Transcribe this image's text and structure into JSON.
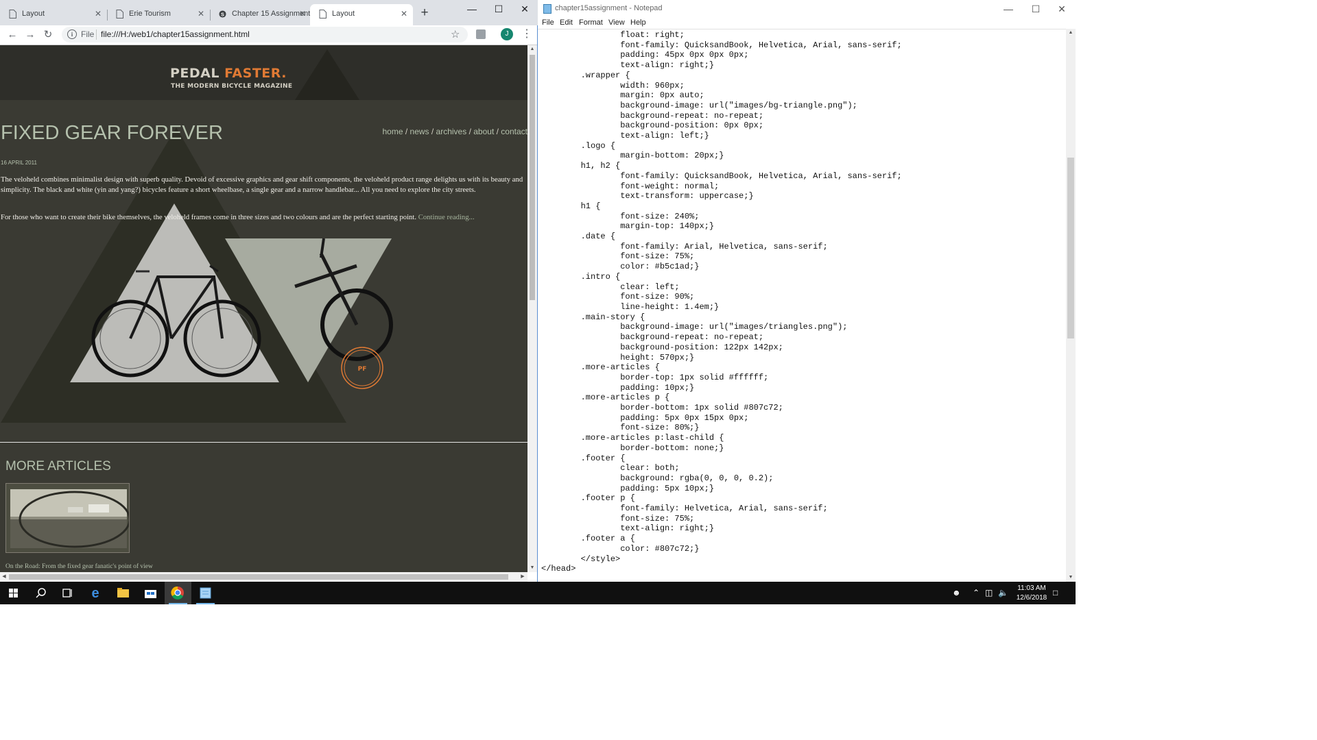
{
  "browser": {
    "tabs": [
      {
        "title": "Layout"
      },
      {
        "title": "Erie Tourism"
      },
      {
        "title": "Chapter 15 Assignment"
      },
      {
        "title": "Layout"
      }
    ],
    "address_scheme": "File",
    "address_url": "file:///H:/web1/chapter15assignment.html",
    "avatar_letter": "J"
  },
  "page": {
    "logo_word1": "PEDAL",
    "logo_word2": "FASTER.",
    "logo_tagline": "THE MODERN BICYCLE MAGAZINE",
    "nav": [
      "home",
      "news",
      "archives",
      "about",
      "contact"
    ],
    "nav_separator": " / ",
    "h1": "FIXED GEAR FOREVER",
    "date": "16 APRIL 2011",
    "p1": "The veloheld combines minimalist design with superb quality. Devoid of excessive graphics and gear shift components, the veloheld product range delights us with its beauty and simplicity. The black and white (yin and yang?) bicycles feature a short wheelbase, a single gear and a narrow handlebar... All you need to explore the city streets.",
    "p2": "For those who want to create their bike themselves, the veloheld frames come in three sizes and two colours and are the perfect starting point.",
    "continue_link": "Continue reading...",
    "badge_letters": "PF",
    "more_articles_heading": "MORE ARTICLES",
    "article_caption": "On the Road: From the fixed gear fanatic's point of view",
    "colors": {
      "green": "#b5c1ad",
      "orange": "#e07a34",
      "border": "#807c72",
      "background": "#3a3a33"
    }
  },
  "notepad": {
    "title": "chapter15assignment - Notepad",
    "menu": [
      "File",
      "Edit",
      "Format",
      "View",
      "Help"
    ],
    "code": "                float: right;\n                font-family: QuicksandBook, Helvetica, Arial, sans-serif;\n                padding: 45px 0px 0px 0px;\n                text-align: right;}\n        .wrapper {\n                width: 960px;\n                margin: 0px auto;\n                background-image: url(\"images/bg-triangle.png\");\n                background-repeat: no-repeat;\n                background-position: 0px 0px;\n                text-align: left;}\n        .logo {\n                margin-bottom: 20px;}\n        h1, h2 {\n                font-family: QuicksandBook, Helvetica, Arial, sans-serif;\n                font-weight: normal;\n                text-transform: uppercase;}\n        h1 {\n                font-size: 240%;\n                margin-top: 140px;}\n        .date {\n                font-family: Arial, Helvetica, sans-serif;\n                font-size: 75%;\n                color: #b5c1ad;}\n        .intro {\n                clear: left;\n                font-size: 90%;\n                line-height: 1.4em;}\n        .main-story {\n                background-image: url(\"images/triangles.png\");\n                background-repeat: no-repeat;\n                background-position: 122px 142px;\n                height: 570px;}\n        .more-articles {\n                border-top: 1px solid #ffffff;\n                padding: 10px;}\n        .more-articles p {\n                border-bottom: 1px solid #807c72;\n                padding: 5px 0px 15px 0px;\n                font-size: 80%;}\n        .more-articles p:last-child {\n                border-bottom: none;}\n        .footer {\n                clear: both;\n                background: rgba(0, 0, 0, 0.2);\n                padding: 5px 10px;}\n        .footer p {\n                font-family: Helvetica, Arial, sans-serif;\n                font-size: 75%;\n                text-align: right;}\n        .footer a {\n                color: #807c72;}\n        </style>\n</head>"
  },
  "taskbar": {
    "time": "11:03 AM",
    "date": "12/6/2018",
    "apps": [
      "start-icon",
      "search-icon",
      "task-view-icon",
      "edge-icon",
      "file-explorer-icon",
      "store-icon",
      "chrome-icon",
      "notepad-icon"
    ]
  }
}
